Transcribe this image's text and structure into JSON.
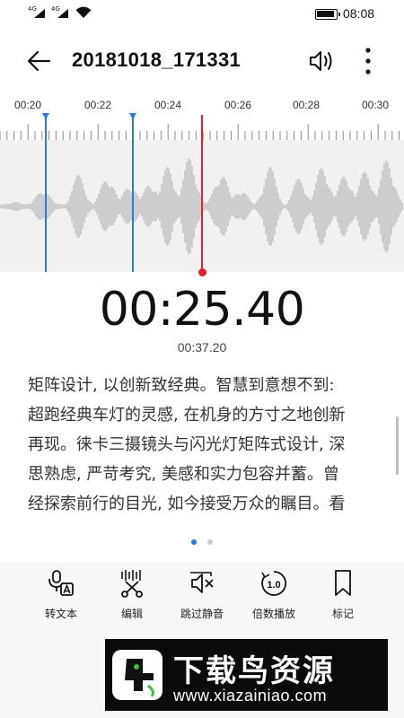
{
  "status_bar": {
    "network_1": "4G",
    "network_2": "4G",
    "time": "08:08"
  },
  "header": {
    "title": "20181018_171331",
    "icons": [
      "back-arrow-icon",
      "speaker-icon",
      "more-vertical-icon"
    ]
  },
  "timeline": {
    "tick_labels": [
      "00:20",
      "00:22",
      "00:24",
      "00:26",
      "00:28",
      "00:30"
    ]
  },
  "player": {
    "current_time": "00:25.40",
    "total_time": "00:37.20"
  },
  "transcript": {
    "lines": [
      "矩阵设计, 以创新致经典。智慧到意想不到:",
      "超跑经典车灯的灵感, 在机身的方寸之地创新",
      "再现。徕卡三摄镜头与闪光灯矩阵式设计, 深",
      "思熟虑, 严苛考究, 美感和实力包容并蓄。曾",
      "经探索前行的目光, 如今接受万众的瞩目。看"
    ]
  },
  "pager": {
    "pages": 2,
    "active_index": 0
  },
  "actions": [
    {
      "label": "转文本",
      "icon": "speech-to-text-icon"
    },
    {
      "label": "编辑",
      "icon": "scissors-edit-icon"
    },
    {
      "label": "跳过静音",
      "icon": "skip-silence-icon"
    },
    {
      "label": "倍数播放",
      "icon": "playback-speed-icon"
    },
    {
      "label": "标记",
      "icon": "bookmark-icon"
    }
  ],
  "watermark": {
    "title": "下载鸟资源",
    "url": "www.xiazainiao.com"
  },
  "colors": {
    "accent": "#2a7bdb",
    "playhead": "#e2232b",
    "waveform": "#a9a9a9",
    "wave_background": "#f1f1f1",
    "text": "#333333"
  }
}
